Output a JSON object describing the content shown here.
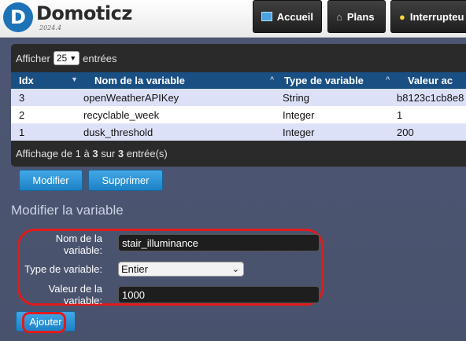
{
  "app": {
    "name": "Domoticz",
    "version": "2024.4",
    "logo_letter": "D"
  },
  "nav": [
    {
      "label": "Accueil",
      "icon": "home-screen-icon"
    },
    {
      "label": "Plans",
      "icon": "house-icon"
    },
    {
      "label": "Interrupteu",
      "icon": "lightbulb-icon"
    }
  ],
  "table": {
    "show_label": "Afficher",
    "page_length": "25",
    "entries_label": "entrées",
    "columns": [
      "Idx",
      "Nom de la variable",
      "Type de variable",
      "Valeur ac"
    ],
    "rows": [
      {
        "idx": "3",
        "name": "openWeatherAPIKey",
        "type": "String",
        "value": "b8123c1cb8e8"
      },
      {
        "idx": "2",
        "name": "recyclable_week",
        "type": "Integer",
        "value": "1"
      },
      {
        "idx": "1",
        "name": "dusk_threshold",
        "type": "Integer",
        "value": "200"
      }
    ],
    "footer": {
      "prefix": "Affichage de ",
      "from": "1",
      "mid1": " à ",
      "to": "3",
      "mid2": " sur ",
      "total": "3",
      "suffix": " entrée(s)"
    }
  },
  "actions": {
    "modify": "Modifier",
    "delete": "Supprimer"
  },
  "form": {
    "title": "Modifier la variable",
    "name_label": "Nom de la variable:",
    "name_value": "stair_illuminance",
    "type_label": "Type de variable:",
    "type_value": "Entier",
    "value_label": "Valeur de la variable:",
    "value_value": "1000",
    "add_button": "Ajouter"
  },
  "colors": {
    "background": "#4a5470",
    "header_blue": "#1a4f84",
    "button_blue": "#2e93d6",
    "highlight_red": "#e01b1b",
    "row_alt": "#dde1f8"
  }
}
